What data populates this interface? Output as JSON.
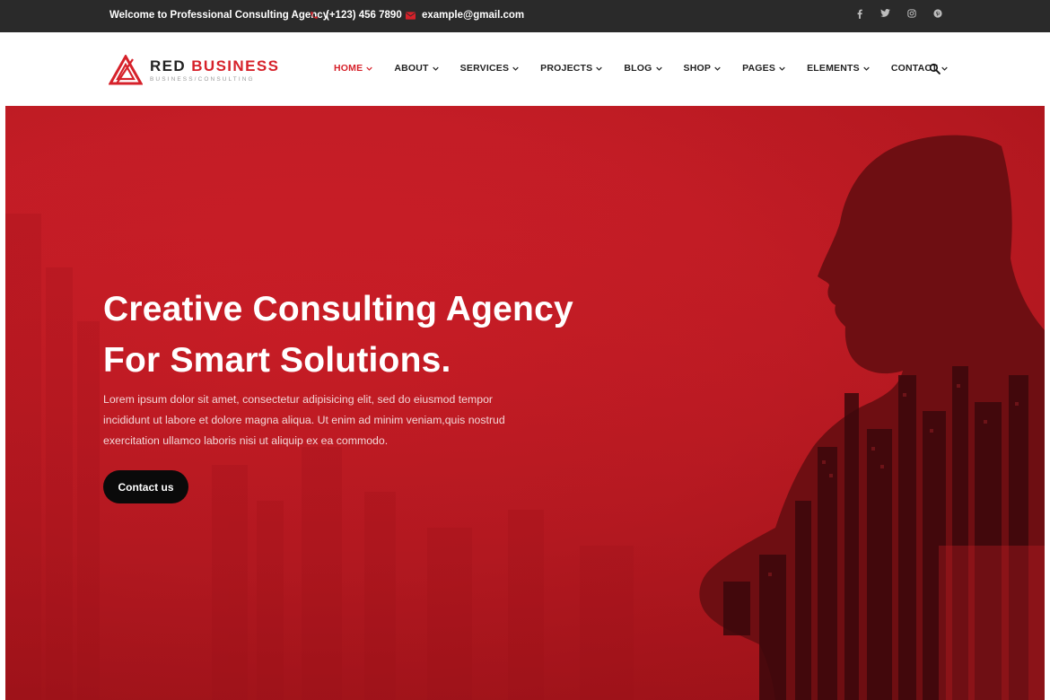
{
  "topbar": {
    "welcome": "Welcome to Professional Consulting Agency",
    "phone": "(+123) 456 7890",
    "email": "example@gmail.com",
    "phone_icon": "phone-icon",
    "email_icon": "envelope-icon",
    "socials": [
      "facebook-icon",
      "twitter-icon",
      "instagram-icon",
      "pinterest-icon"
    ]
  },
  "brand": {
    "name_part1": "RED",
    "name_part2": "BUSINESS",
    "tagline": "BUSINESS/CONSULTING",
    "accent": "#d6212a"
  },
  "nav": {
    "items": [
      {
        "label": "HOME",
        "active": true
      },
      {
        "label": "ABOUT"
      },
      {
        "label": "SERVICES"
      },
      {
        "label": "PROJECTS"
      },
      {
        "label": "BLOG"
      },
      {
        "label": "SHOP"
      },
      {
        "label": "PAGES"
      },
      {
        "label": "ELEMENTS"
      },
      {
        "label": "CONTACT"
      }
    ],
    "search_icon": "search-icon"
  },
  "hero": {
    "title_line1": "Creative Consulting Agency",
    "title_line2": "For Smart Solutions.",
    "text": "Lorem ipsum dolor sit amet, consectetur adipisicing elit, sed do eiusmod tempor incididunt ut labore et dolore magna aliqua. Ut enim ad minim veniam,quis nostrud exercitation ullamco laboris nisi ut aliquip ex ea commodo.",
    "cta": "Contact us",
    "background_color": "#c41d26"
  }
}
